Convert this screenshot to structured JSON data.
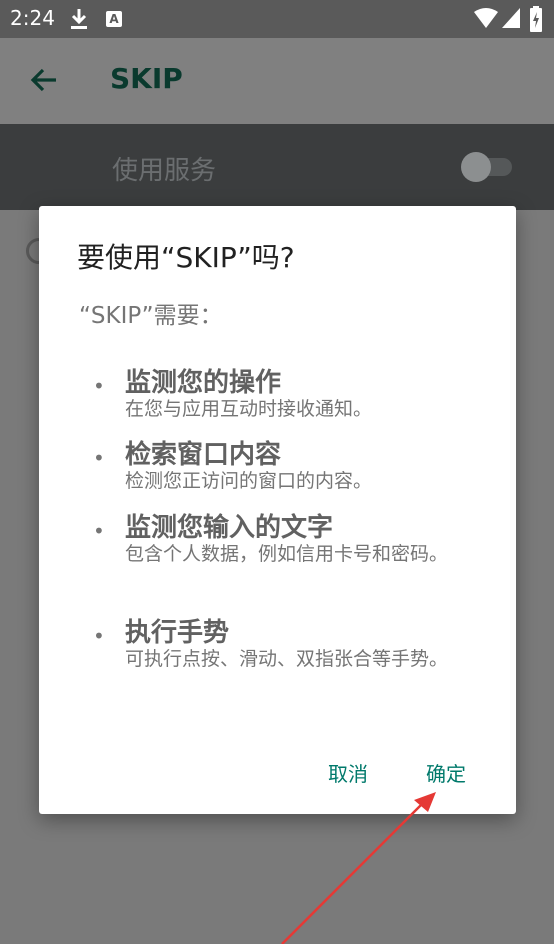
{
  "status_bar": {
    "time": "2:24",
    "notification_letter": "A",
    "icons": [
      "download-icon",
      "a-notification-icon",
      "wifi-icon",
      "signal-icon",
      "battery-icon"
    ]
  },
  "app_bar": {
    "title": "SKIP",
    "back_icon": "arrow-left-icon"
  },
  "service_row": {
    "label": "使用服务",
    "toggle_on": false
  },
  "dialog": {
    "title": "要使用“SKIP”吗?",
    "subtitle": "“SKIP”需要：",
    "bullet": "•",
    "permissions": [
      {
        "title": "监测您的操作",
        "description": "在您与应用互动时接收通知。"
      },
      {
        "title": "检索窗口内容",
        "description": "检测您正访问的窗口的内容。"
      },
      {
        "title": "监测您输入的文字",
        "description": "包含个人数据，例如信用卡号和密码。"
      },
      {
        "title": "执行手势",
        "description": "可执行点按、滑动、双指张合等手势。"
      }
    ],
    "cancel_label": "取消",
    "confirm_label": "确定"
  },
  "colors": {
    "accent": "#00796b",
    "annotation_arrow": "#e53935"
  }
}
